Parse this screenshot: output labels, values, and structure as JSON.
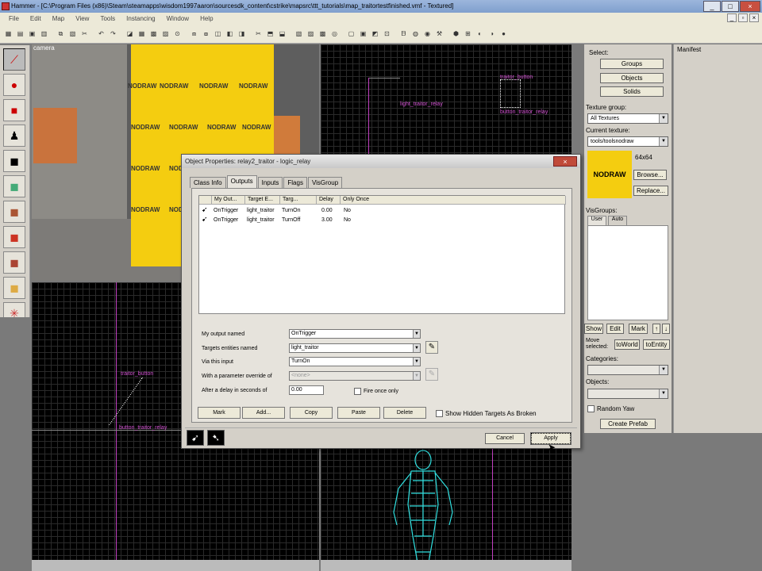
{
  "window": {
    "title": "Hammer - [C:\\Program Files (x86)\\Steam\\steamapps\\wisdom1997aaron\\sourcesdk_content\\cstrike\\mapsrc\\ttt_tutorials\\map_traitortestfinished.vmf - Textured]"
  },
  "menu": [
    "File",
    "Edit",
    "Map",
    "View",
    "Tools",
    "Instancing",
    "Window",
    "Help"
  ],
  "views": {
    "camera_label": "camera",
    "nodraw_text": "NODRAW",
    "tr_labels": [
      "traitor_button",
      "light_traitor_relay",
      "button_traitor_relay"
    ],
    "bl_labels": [
      "traitor_button",
      "button_traitor_relay"
    ]
  },
  "right_panel": {
    "select_label": "Select:",
    "groups": "Groups",
    "objects": "Objects",
    "solids": "Solids",
    "texture_group_label": "Texture group:",
    "texture_group_value": "All Textures",
    "current_texture_label": "Current texture:",
    "current_texture_value": "tools/toolsnodraw",
    "texture_size": "64x64",
    "texture_name": "NODRAW",
    "browse": "Browse...",
    "replace": "Replace...",
    "visgroups_label": "VisGroups:",
    "visgroup_tabs": [
      "User",
      "Auto"
    ],
    "show": "Show",
    "edit": "Edit",
    "mark": "Mark",
    "move_selected_label": "Move selected:",
    "to_world": "toWorld",
    "to_entity": "toEntity",
    "categories_label": "Categories:",
    "objects_label": "Objects:",
    "random_yaw": "Random Yaw",
    "create_prefab": "Create Prefab"
  },
  "manifest": {
    "label": "Manifest"
  },
  "dialog": {
    "title": "Object Properties: relay2_traitor - logic_relay",
    "tabs": [
      "Class Info",
      "Outputs",
      "Inputs",
      "Flags",
      "VisGroup"
    ],
    "active_tab": 1,
    "columns": [
      "My Out...",
      "Target E...",
      "Targ...",
      "Delay",
      "Only Once"
    ],
    "rows": [
      {
        "output": "OnTrigger",
        "target": "light_traitor",
        "input": "TurnOn",
        "delay": "0.00",
        "once": "No"
      },
      {
        "output": "OnTrigger",
        "target": "light_traitor",
        "input": "TurnOff",
        "delay": "3.00",
        "once": "No"
      }
    ],
    "fields": {
      "my_output_label": "My output named",
      "my_output_value": "OnTrigger",
      "targets_label": "Targets entities named",
      "targets_value": "light_traitor",
      "via_input_label": "Via this input",
      "via_input_value": "TurnOn",
      "param_label": "With a parameter override of",
      "param_value": "<none>",
      "delay_label": "After a delay in seconds of",
      "delay_value": "0.00",
      "fire_once": "Fire once only"
    },
    "buttons": {
      "mark": "Mark",
      "add": "Add...",
      "copy": "Copy",
      "paste": "Paste",
      "delete": "Delete",
      "show_hidden": "Show Hidden Targets As Broken",
      "cancel": "Cancel",
      "apply": "Apply"
    }
  }
}
